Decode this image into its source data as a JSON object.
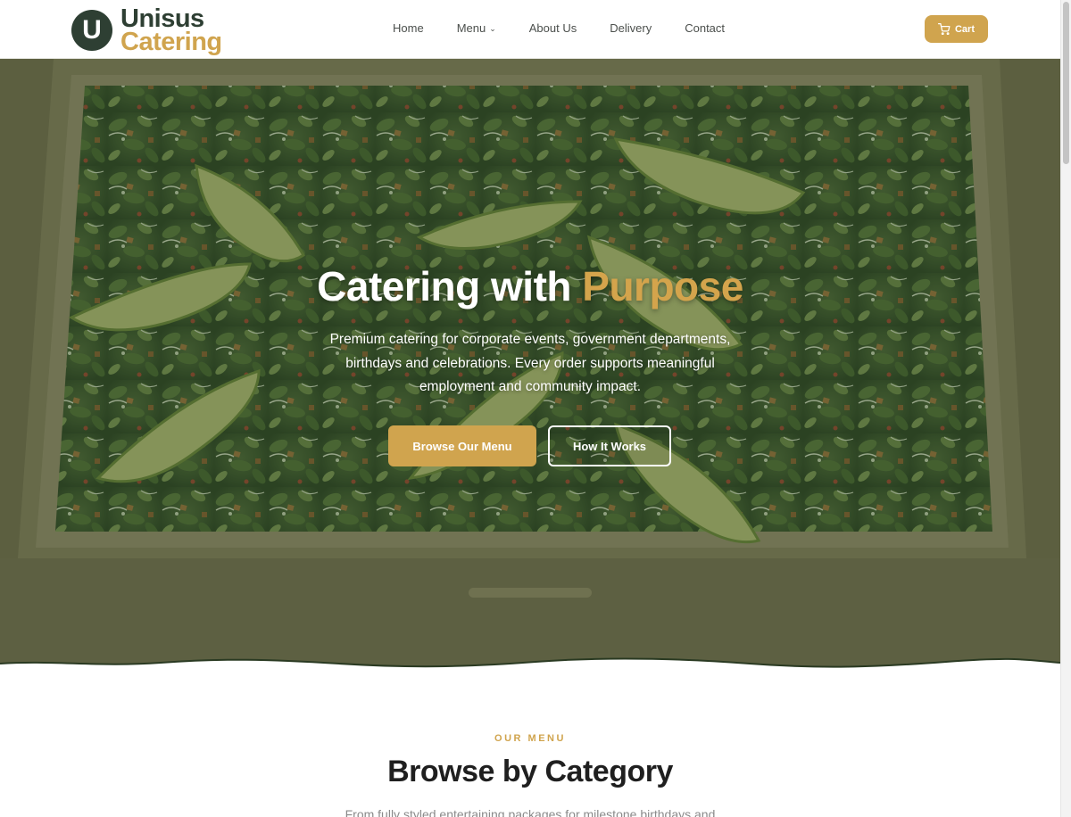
{
  "brand": {
    "mark": "U",
    "word1": "Unisus",
    "word2": "Catering"
  },
  "nav": {
    "items": [
      {
        "label": "Home"
      },
      {
        "label": "Menu",
        "has_dropdown": true
      },
      {
        "label": "About Us"
      },
      {
        "label": "Delivery"
      },
      {
        "label": "Contact"
      }
    ]
  },
  "cart": {
    "label": "Cart",
    "icon": "cart-icon"
  },
  "hero": {
    "title_main": "Catering with",
    "title_accent": "Purpose",
    "subtitle": "Premium catering for corporate events, government departments, birthdays and celebrations. Every order supports meaningful employment and community impact.",
    "primary_button": "Browse Our Menu",
    "secondary_button": "How It Works"
  },
  "menu_section": {
    "eyebrow": "OUR MENU",
    "title": "Browse by Category",
    "description": "From fully styled entertaining packages for milestone birthdays and"
  },
  "colors": {
    "brand_green": "#2e3f33",
    "accent_gold": "#d0a44e"
  }
}
